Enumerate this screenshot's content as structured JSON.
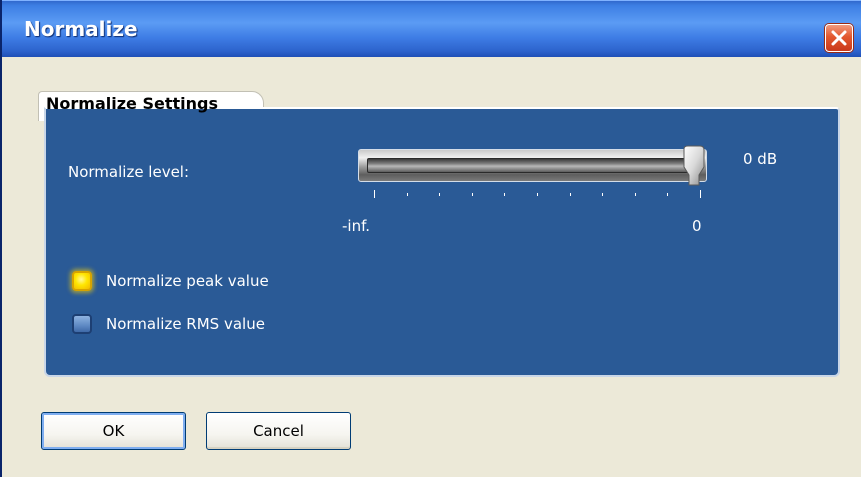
{
  "window": {
    "title": "Normalize"
  },
  "group": {
    "title": "Normalize Settings"
  },
  "level": {
    "label": "Normalize level:",
    "value_text": "0 dB",
    "slider_fraction": 1.0,
    "min_label": "-inf.",
    "max_label": "0"
  },
  "options": [
    {
      "label": "Normalize peak value",
      "selected": true
    },
    {
      "label": "Normalize RMS value",
      "selected": false
    }
  ],
  "buttons": {
    "ok": "OK",
    "cancel": "Cancel"
  },
  "colors": {
    "titlebar": "#3d7fe4",
    "panel": "#2a5a96",
    "selected_option": "#ffe600",
    "close_button": "#e3582e"
  },
  "icons": {
    "close": "close-icon"
  }
}
